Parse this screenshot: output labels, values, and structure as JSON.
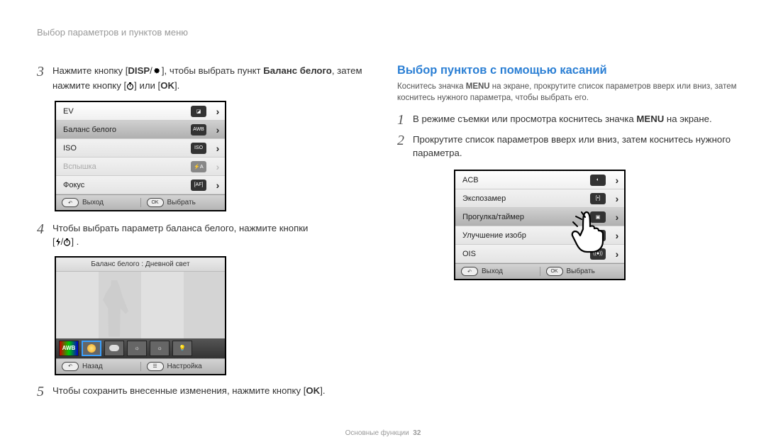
{
  "header": "Выбор параметров и пунктов меню",
  "left": {
    "step3_a": "Нажмите кнопку [",
    "step3_b": "], чтобы выбрать пункт ",
    "step3_strong": "Баланс белого",
    "step3_c": ", затем нажмите кнопку [",
    "step3_d": "] или [",
    "step3_e": "].",
    "disp_word": "DISP",
    "ok_word": "OK",
    "menu": {
      "ev": "EV",
      "wb": "Баланс белого",
      "iso": "ISO",
      "flash": "Вспышка",
      "focus": "Фокус",
      "exit": "Выход",
      "select": "Выбрать",
      "ok": "OK"
    },
    "step4_a": "Чтобы выбрать параметр баланса белого, нажмите кнопки",
    "step4_b": "[",
    "step4_c": "] .",
    "wb_title": "Баланс белого : Дневной свет",
    "wb_back": "Назад",
    "wb_set": "Настройка",
    "step5": "Чтобы сохранить внесенные изменения, нажмите кнопку [",
    "step5_b": "]."
  },
  "right": {
    "title": "Выбор пунктов с помощью касаний",
    "sub_a": "Коснитесь значка ",
    "sub_b": " на экране, прокрутите список параметров вверх или вниз, затем коснитесь нужного параметра, чтобы выбрать его.",
    "menu_word": "MENU",
    "step1_a": "В режиме съемки или просмотра коснитесь значка ",
    "step1_b": " на экране.",
    "step2": "Прокрутите список параметров вверх или вниз, затем коснитесь нужного параметра.",
    "menu": {
      "acb": "ACB",
      "meter": "Экспозамер",
      "drive": "Прогулка/таймер",
      "enhance": "Улучшение изобр",
      "ois": "OIS",
      "exit": "Выход",
      "select": "Выбрать",
      "ok": "OK"
    }
  },
  "footer_a": "Основные функции",
  "footer_b": "32"
}
